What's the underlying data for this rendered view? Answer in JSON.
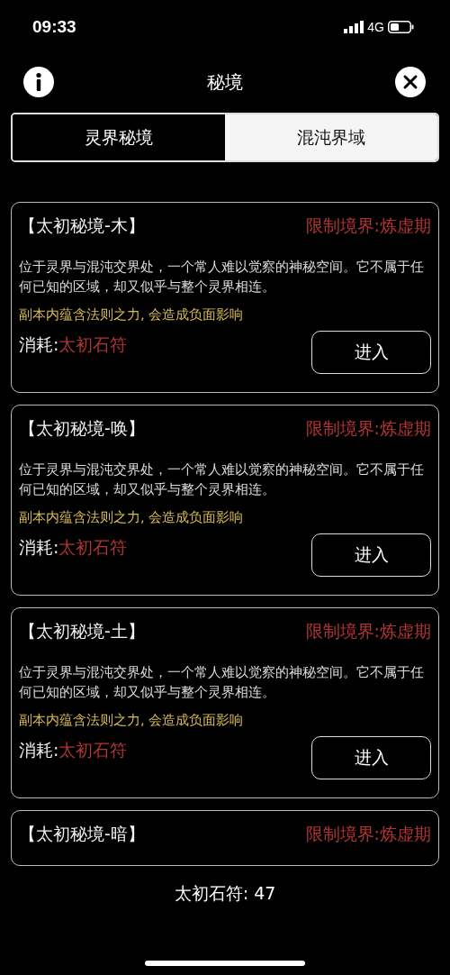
{
  "status_bar": {
    "time": "09:33",
    "network": "4G"
  },
  "header": {
    "title": "秘境"
  },
  "tabs": [
    {
      "label": "灵界秘境",
      "selected": true
    },
    {
      "label": "混沌界域",
      "selected": false
    }
  ],
  "realms": [
    {
      "title": "【太初秘境-木】",
      "restriction": "限制境界:炼虚期",
      "description": "位于灵界与混沌交界处，一个常人难以觉察的神秘空间。它不属于任何已知的区域，却又似乎与整个灵界相连。",
      "warning": "副本内蕴含法则之力, 会造成负面影响",
      "cost_label": "消耗:",
      "cost_item": "太初石符",
      "button": "进入"
    },
    {
      "title": "【太初秘境-唤】",
      "restriction": "限制境界:炼虚期",
      "description": "位于灵界与混沌交界处，一个常人难以觉察的神秘空间。它不属于任何已知的区域，却又似乎与整个灵界相连。",
      "warning": "副本内蕴含法则之力, 会造成负面影响",
      "cost_label": "消耗:",
      "cost_item": "太初石符",
      "button": "进入"
    },
    {
      "title": "【太初秘境-土】",
      "restriction": "限制境界:炼虚期",
      "description": "位于灵界与混沌交界处，一个常人难以觉察的神秘空间。它不属于任何已知的区域，却又似乎与整个灵界相连。",
      "warning": "副本内蕴含法则之力, 会造成负面影响",
      "cost_label": "消耗:",
      "cost_item": "太初石符",
      "button": "进入"
    },
    {
      "title": "【太初秘境-暗】",
      "restriction": "限制境界:炼虚期"
    }
  ],
  "footer": {
    "balance": "太初石符: 47"
  }
}
